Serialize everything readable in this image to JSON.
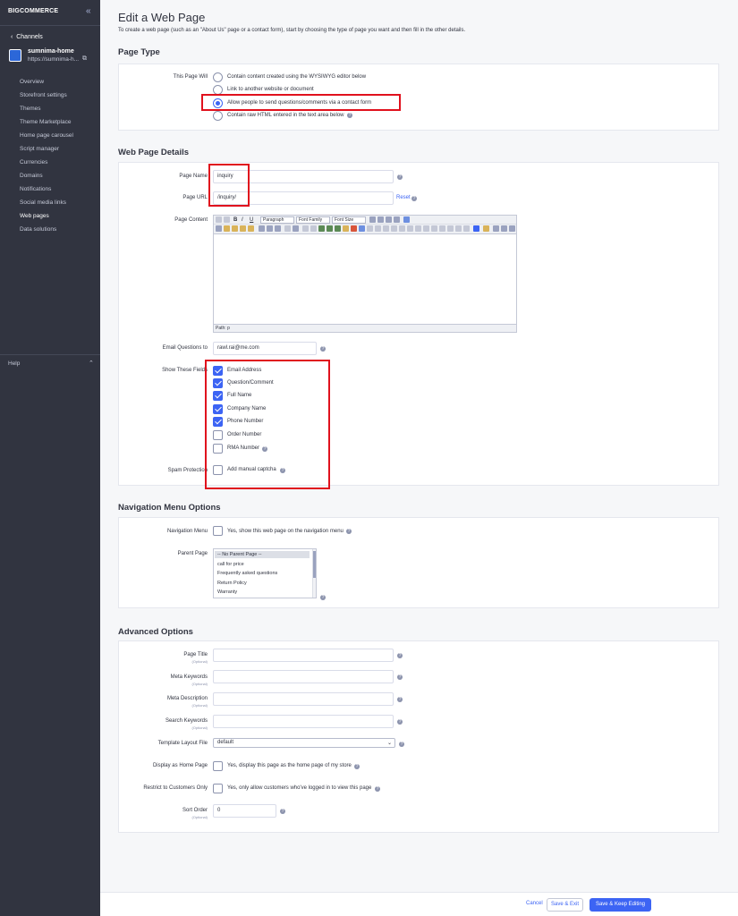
{
  "sidebar": {
    "logo": "BIGCOMMERCE",
    "channels_label": "Channels",
    "store_name": "sumnima-home",
    "store_url": "https://sumnima-h...",
    "items": [
      {
        "label": "Overview"
      },
      {
        "label": "Storefront settings"
      },
      {
        "label": "Themes"
      },
      {
        "label": "Theme Marketplace"
      },
      {
        "label": "Home page carousel"
      },
      {
        "label": "Script manager"
      },
      {
        "label": "Currencies"
      },
      {
        "label": "Domains"
      },
      {
        "label": "Notifications"
      },
      {
        "label": "Social media links"
      },
      {
        "label": "Web pages"
      },
      {
        "label": "Data solutions"
      }
    ],
    "help_label": "Help"
  },
  "header": {
    "title": "Edit a Web Page",
    "subtitle": "To create a web page (such as an \"About Us\" page or a contact form), start by choosing the type of page you want and then fill in the other details."
  },
  "page_type": {
    "title": "Page Type",
    "label": "This Page Will",
    "options": [
      {
        "label": "Contain content created using the WYSIWYG editor below",
        "selected": false
      },
      {
        "label": "Link to another website or document",
        "selected": false
      },
      {
        "label": "Allow people to send questions/comments via a contact form",
        "selected": true
      },
      {
        "label": "Contain raw HTML entered in the text area below",
        "selected": false
      }
    ]
  },
  "details": {
    "title": "Web Page Details",
    "page_name_label": "Page Name",
    "page_name_value": "inquiry",
    "page_url_label": "Page URL",
    "page_url_value": "/inquiry/",
    "reset_label": "Reset",
    "page_content_label": "Page Content",
    "editor": {
      "format_dropdown": "Paragraph",
      "font_family_dropdown": "Font Family",
      "font_size_dropdown": "Font Size",
      "path_label": "Path: p"
    },
    "email_label": "Email Questions to",
    "email_value": "rawl.rai@me.com",
    "fields_label": "Show These Fields",
    "fields": [
      {
        "label": "Email Address",
        "checked": true
      },
      {
        "label": "Question/Comment",
        "checked": true
      },
      {
        "label": "Full Name",
        "checked": true
      },
      {
        "label": "Company Name",
        "checked": true
      },
      {
        "label": "Phone Number",
        "checked": true
      },
      {
        "label": "Order Number",
        "checked": false
      },
      {
        "label": "RMA Number",
        "checked": false
      }
    ],
    "spam_label": "Spam Protection",
    "spam_option": "Add manual captcha"
  },
  "nav": {
    "title": "Navigation Menu Options",
    "menu_label": "Navigation Menu",
    "menu_option": "Yes, show this web page on the navigation menu",
    "parent_label": "Parent Page",
    "parent_options": [
      "-- No Parent Page --",
      "call for price",
      "Frequently asked questions",
      "Return Policy",
      "Warranty"
    ]
  },
  "advanced": {
    "title": "Advanced Options",
    "optional": "(Optional)",
    "page_title_label": "Page Title",
    "meta_keywords_label": "Meta Keywords",
    "meta_description_label": "Meta Description",
    "search_keywords_label": "Search Keywords",
    "template_label": "Template Layout File",
    "template_value": "default",
    "home_label": "Display as Home Page",
    "home_option": "Yes, display this page as the home page of my store",
    "restrict_label": "Restrict to Customers Only",
    "restrict_option": "Yes, only allow customers who've logged in to view this page",
    "sort_label": "Sort Order",
    "sort_value": "0"
  },
  "footer": {
    "cancel": "Cancel",
    "save_exit": "Save & Exit",
    "save_keep": "Save & Keep Editing"
  },
  "colors": {
    "sidebar": "#313440",
    "accent": "#3c64f4",
    "highlight": "#e0111d"
  }
}
